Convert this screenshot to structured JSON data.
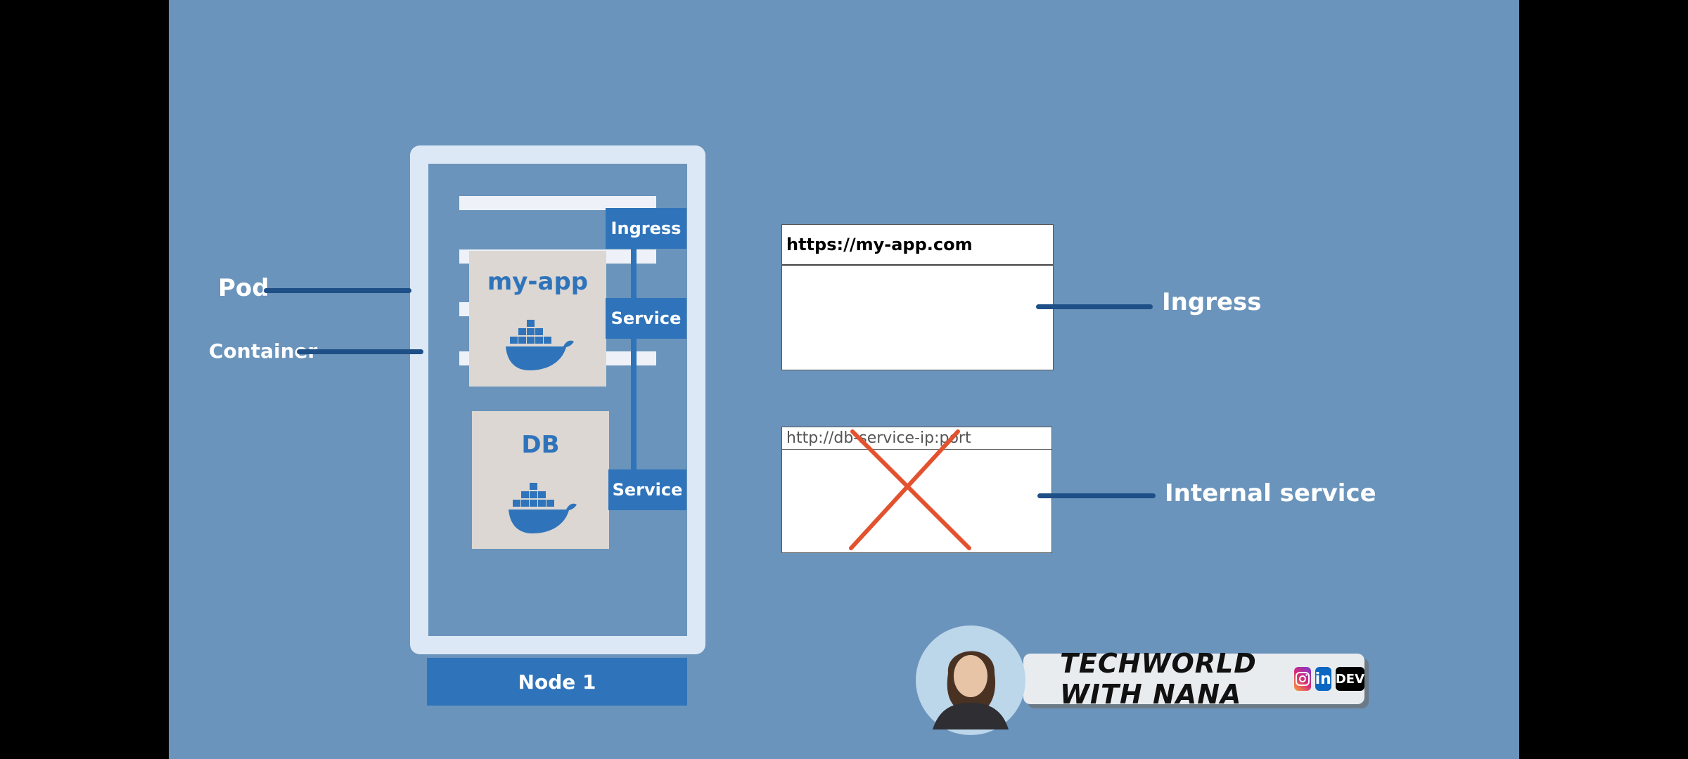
{
  "diagram": {
    "node_label": "Node 1",
    "pods": [
      {
        "title": "my-app"
      },
      {
        "title": "DB"
      }
    ],
    "tags": {
      "ingress": "Ingress",
      "service_app": "Service",
      "service_db": "Service"
    },
    "left_labels": {
      "pod": "Pod",
      "container": "Container"
    },
    "right_labels": {
      "ingress": "Ingress",
      "internal": "Internal service"
    },
    "browsers": {
      "public_url": "https://my-app.com",
      "internal_url": "http://db-service-ip:port"
    }
  },
  "branding": {
    "channel": "TECHWORLD WITH NANA",
    "social_icons": [
      "instagram-icon",
      "linkedin-icon",
      "dev-icon"
    ],
    "social_text": {
      "linkedin": "in",
      "dev": "DEV"
    }
  },
  "colors": {
    "background": "#6a94bb",
    "accent": "#2f74bb",
    "cross": "#e3522e"
  }
}
